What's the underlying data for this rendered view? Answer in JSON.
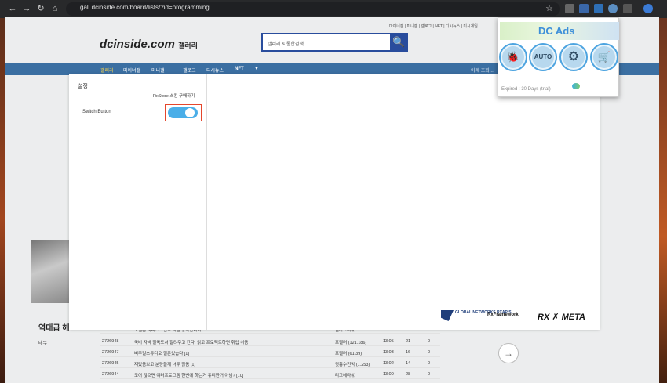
{
  "browser": {
    "url": "gall.dcinside.com/board/lists/?id=programming",
    "back_icon": "←",
    "forward_icon": "→",
    "reload_icon": "↻",
    "home_icon": "⌂",
    "star_icon": "☆"
  },
  "site": {
    "top_menu": "마이너갤 | 미니갤 | 갤로그 | NFT | 디시뉴스 | 디시게임",
    "logo_main": "dcinside.com",
    "logo_sub": "갤러리",
    "search_placeholder": "갤러리 & 통합검색",
    "search_icon": "🔍",
    "nav": [
      "갤러리",
      "마이너갤",
      "미니갤",
      "갤로그",
      "디시뉴스",
      "NFT",
      "▼"
    ],
    "nav_right": "어제 조회 ..."
  },
  "modal": {
    "settings_title": "설정",
    "rxstore_link": "RxStore 스킨 구매하기",
    "switch_label": "Switch Button",
    "switch_on": true,
    "logos": [
      "GLOBAL NETWORKS RXAPIS",
      "RxFramework",
      "RX ✗ META"
    ]
  },
  "background_board": {
    "left_title": "역대급 헤",
    "left_sub": "태무",
    "rows": [
      {
        "id": "2726948",
        "title": "모델은 자바스크립트 처럼 동작합니까",
        "author": "월아그리ⓖ",
        "time": "13:05",
        "views": "17",
        "rec": "0"
      },
      {
        "id": "2726948",
        "title": "국비 자바 밀육도서 알려주고 간다. 읽고 프로젝트하면 취업 쉬움",
        "author": "프갤러 (121.186)",
        "time": "13:05",
        "views": "21",
        "rec": "0"
      },
      {
        "id": "2726947",
        "title": "비주얼스튜디오 질문있습다 [1]",
        "author": "프갤러 (61.39)",
        "time": "13:03",
        "views": "16",
        "rec": "0"
      },
      {
        "id": "2726945",
        "title": "재밌음보고 분양들게 너무 많음 [1]",
        "author": "뒷통수천박 (1.253)",
        "time": "13:02",
        "views": "14",
        "rec": "0"
      },
      {
        "id": "2726944",
        "title": "코어 많으면 여러프로그램 한번에 하는거 유리한거 아님? [10]",
        "author": "리그네타ⓖ",
        "time": "13:00",
        "views": "28",
        "rec": "0"
      }
    ],
    "next_arrow": "→"
  },
  "extension_popup": {
    "title": "DC Ads",
    "buttons": [
      {
        "name": "bug-icon",
        "glyph": "🐞"
      },
      {
        "name": "auto-icon",
        "glyph": "AUTO"
      },
      {
        "name": "gear-icon",
        "glyph": "⚙"
      },
      {
        "name": "cart-icon",
        "glyph": "🛒"
      }
    ],
    "expired": "Expired : 30 Days (trial)"
  },
  "colors": {
    "accent_blue": "#294d9d",
    "switch_blue": "#4aaee8",
    "highlight_red": "#e5462c",
    "popup_title": "#3d8fd9"
  }
}
